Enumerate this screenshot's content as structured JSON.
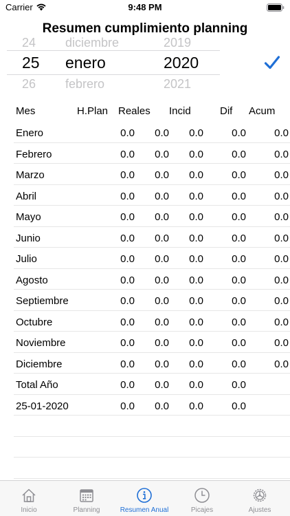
{
  "status_bar": {
    "carrier": "Carrier",
    "time": "9:48 PM"
  },
  "title": "Resumen cumplimiento planning",
  "date_picker": {
    "previous": {
      "day": "24",
      "month": "diciembre",
      "year": "2019"
    },
    "selected": {
      "day": "25",
      "month": "enero",
      "year": "2020"
    },
    "next": {
      "day": "26",
      "month": "febrero",
      "year": "2021"
    }
  },
  "table": {
    "columns": [
      "Mes",
      "H.Plan",
      "Reales",
      "Incid",
      "Dif",
      "Acum"
    ],
    "rows": [
      {
        "name": "Enero",
        "values": [
          "0.0",
          "0.0",
          "0.0",
          "0.0",
          "0.0"
        ]
      },
      {
        "name": "Febrero",
        "values": [
          "0.0",
          "0.0",
          "0.0",
          "0.0",
          "0.0"
        ]
      },
      {
        "name": "Marzo",
        "values": [
          "0.0",
          "0.0",
          "0.0",
          "0.0",
          "0.0"
        ]
      },
      {
        "name": "Abril",
        "values": [
          "0.0",
          "0.0",
          "0.0",
          "0.0",
          "0.0"
        ]
      },
      {
        "name": "Mayo",
        "values": [
          "0.0",
          "0.0",
          "0.0",
          "0.0",
          "0.0"
        ]
      },
      {
        "name": "Junio",
        "values": [
          "0.0",
          "0.0",
          "0.0",
          "0.0",
          "0.0"
        ]
      },
      {
        "name": "Julio",
        "values": [
          "0.0",
          "0.0",
          "0.0",
          "0.0",
          "0.0"
        ]
      },
      {
        "name": "Agosto",
        "values": [
          "0.0",
          "0.0",
          "0.0",
          "0.0",
          "0.0"
        ]
      },
      {
        "name": "Septiembre",
        "values": [
          "0.0",
          "0.0",
          "0.0",
          "0.0",
          "0.0"
        ]
      },
      {
        "name": "Octubre",
        "values": [
          "0.0",
          "0.0",
          "0.0",
          "0.0",
          "0.0"
        ]
      },
      {
        "name": "Noviembre",
        "values": [
          "0.0",
          "0.0",
          "0.0",
          "0.0",
          "0.0"
        ]
      },
      {
        "name": "Diciembre",
        "values": [
          "0.0",
          "0.0",
          "0.0",
          "0.0",
          "0.0"
        ]
      },
      {
        "name": "Total Año",
        "values": [
          "0.0",
          "0.0",
          "0.0",
          "0.0",
          ""
        ]
      },
      {
        "name": "25-01-2020",
        "values": [
          "0.0",
          "0.0",
          "0.0",
          "0.0",
          ""
        ]
      },
      {
        "name": "",
        "values": [
          "",
          "",
          "",
          "",
          ""
        ]
      },
      {
        "name": "",
        "values": [
          "",
          "",
          "",
          "",
          ""
        ]
      },
      {
        "name": "",
        "values": [
          "",
          "",
          "",
          "",
          ""
        ]
      }
    ]
  },
  "tab_bar": {
    "tabs": [
      {
        "label": "Inicio",
        "icon": "home-icon"
      },
      {
        "label": "Planning",
        "icon": "calendar-icon"
      },
      {
        "label": "Resumen Anual",
        "icon": "info-icon",
        "active": true
      },
      {
        "label": "Picajes",
        "icon": "clock-icon"
      },
      {
        "label": "Ajustes",
        "icon": "gear-icon"
      }
    ]
  },
  "colors": {
    "accent": "#1f6fd6",
    "inactive": "#8e8e93",
    "faded_text": "#c4c4c6"
  }
}
